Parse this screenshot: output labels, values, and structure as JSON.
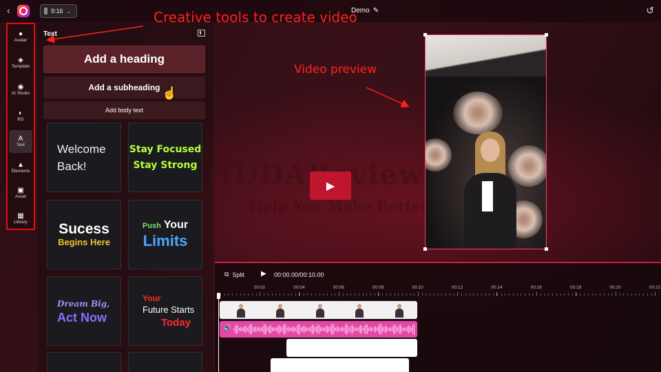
{
  "header": {
    "aspect_ratio": "9:16",
    "project_title": "Demo"
  },
  "annotations": {
    "tools": "Creative tools to create video",
    "preview": "Video preview"
  },
  "sidebar": {
    "items": [
      {
        "label": "Avatar",
        "icon": "user-icon"
      },
      {
        "label": "Template",
        "icon": "layers-icon"
      },
      {
        "label": "AI Studio",
        "icon": "robot-icon"
      },
      {
        "label": "BG",
        "icon": "palette-icon"
      },
      {
        "label": "Text",
        "icon": "text-icon",
        "active": true
      },
      {
        "label": "Elements",
        "icon": "shapes-icon"
      },
      {
        "label": "Asset",
        "icon": "images-icon"
      },
      {
        "label": "Library",
        "icon": "grid-icon"
      }
    ]
  },
  "panel": {
    "title": "Text",
    "add_heading": "Add a heading",
    "add_subheading": "Add a subheading",
    "add_body": "Add body text",
    "templates": {
      "welcome_1": "Welcome",
      "welcome_2": "Back!",
      "focused_1": "Stay Focused",
      "focused_2": "Stay Strong",
      "sucess_1": "Sucess",
      "sucess_2": "Begins Here",
      "limits_push": "Push",
      "limits_your": "Your",
      "limits_word": "Limits",
      "dream_1": "Dream Big,",
      "dream_2": "Act Now",
      "future_your": "Your",
      "future_starts": "Future Starts",
      "future_today": "Today"
    }
  },
  "canvas": {
    "watermark": "HUDAReviews",
    "watermark_sub": "Help You Make Better Decisions"
  },
  "timeline": {
    "split_label": "Split",
    "timecode": "00:00.00/00:10.00",
    "ticks": [
      "00:02",
      "00:04",
      "00:06",
      "00:08",
      "00:10",
      "00:12",
      "00:14",
      "00:16",
      "00:18",
      "00:20",
      "00:22"
    ]
  },
  "colors": {
    "accent": "#c0152f",
    "annotation": "#ff2020",
    "audio_track": "#e547a6"
  }
}
